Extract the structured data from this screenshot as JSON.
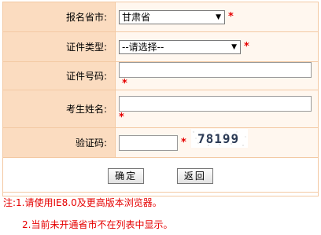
{
  "form": {
    "province_label": "报名省市:",
    "province_value": "甘肃省",
    "cert_type_label": "证件类型:",
    "cert_type_value": "--请选择--",
    "cert_no_label": "证件号码:",
    "name_label": "考生姓名:",
    "captcha_label": "验证码:",
    "captcha_text": "78199",
    "required_mark": "*"
  },
  "buttons": {
    "confirm": "确定",
    "back": "返回"
  },
  "notes": {
    "line1": "注:1.请使用IE8.0及更高版本浏览器。",
    "line2": "2.当前未开通省市不在列表中显示。"
  },
  "colors": {
    "label_bg": "#fbdcc0",
    "value_bg": "#fff7ef",
    "border": "#f3c9a3",
    "required": "#e60000"
  }
}
